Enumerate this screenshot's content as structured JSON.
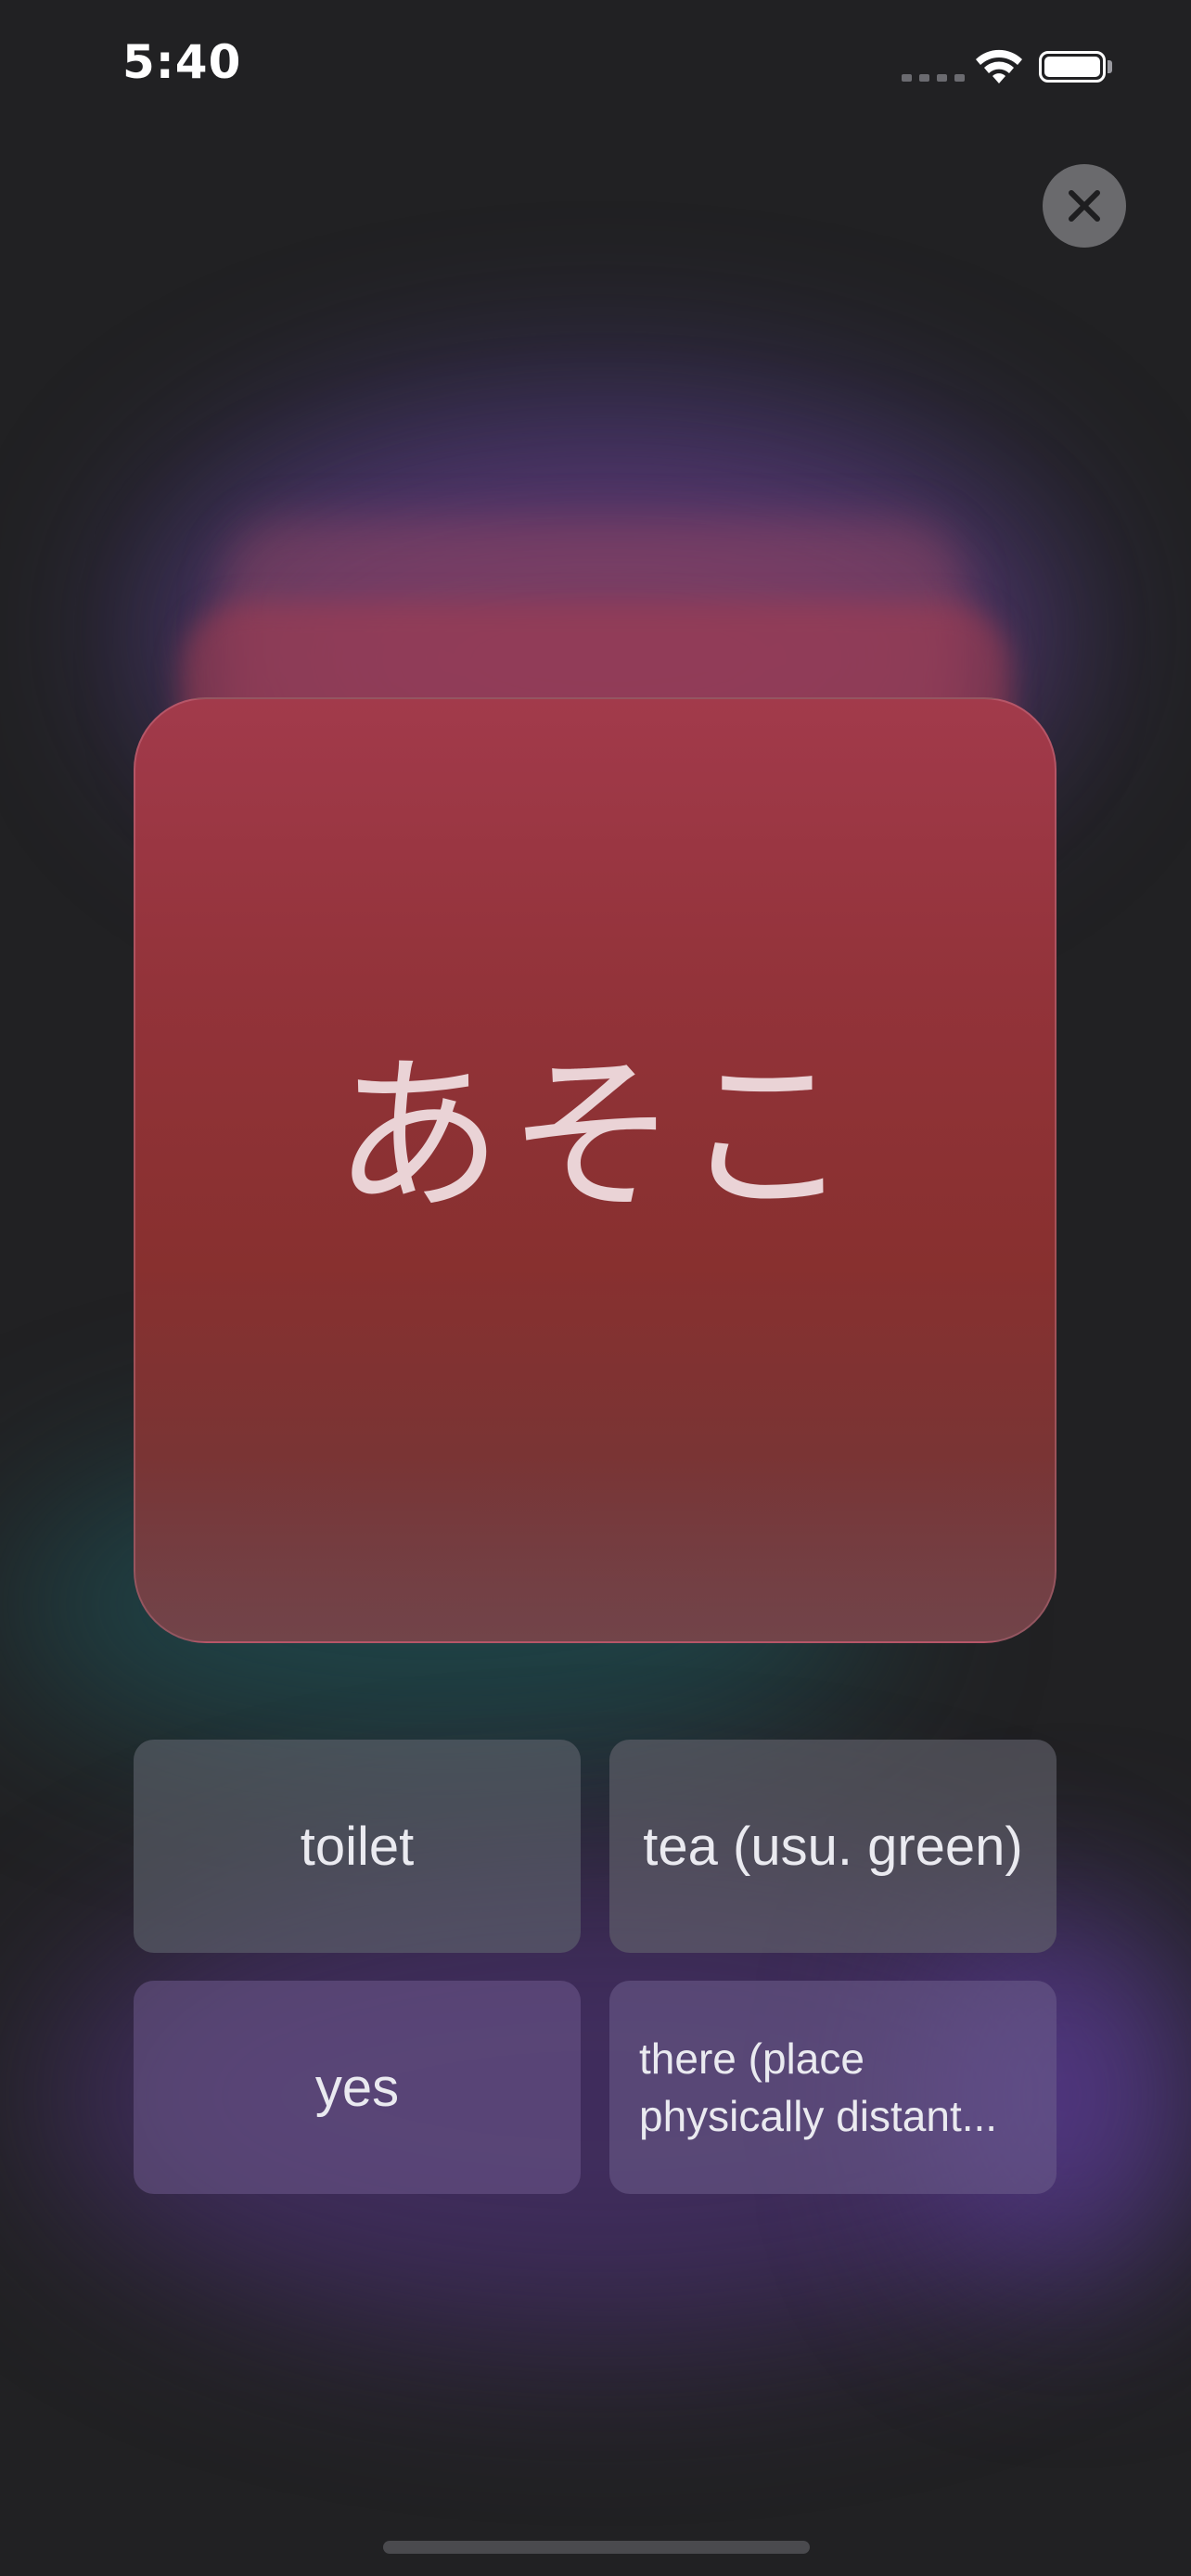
{
  "status_bar": {
    "time": "5:40",
    "icons": [
      "cellular-signal-icon",
      "wifi-icon",
      "battery-icon"
    ]
  },
  "close_button": {
    "icon": "close-icon"
  },
  "flashcard": {
    "word": "あそこ",
    "color": "#93333a"
  },
  "answers": [
    {
      "label": "toilet"
    },
    {
      "label": "tea (usu. green)"
    },
    {
      "label": "yes"
    },
    {
      "label": "there (place physically distant..."
    }
  ]
}
